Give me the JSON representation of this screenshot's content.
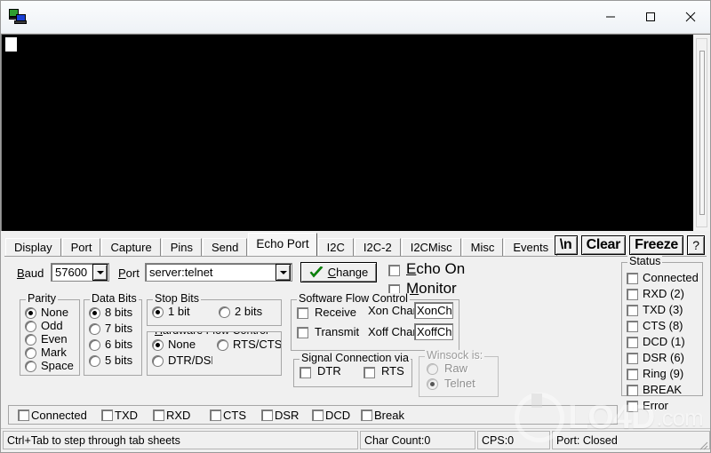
{
  "window": {
    "title": "",
    "icon": "network-computers-icon",
    "controls": {
      "minimize": "minimize-icon",
      "maximize": "maximize-icon",
      "close": "close-icon"
    }
  },
  "terminal": {
    "content": "",
    "background": "#000000",
    "caret": "block-cursor"
  },
  "tabs": [
    {
      "label": "Display",
      "active": false
    },
    {
      "label": "Port",
      "active": false
    },
    {
      "label": "Capture",
      "active": false
    },
    {
      "label": "Pins",
      "active": false
    },
    {
      "label": "Send",
      "active": false
    },
    {
      "label": "Echo Port",
      "active": true
    },
    {
      "label": "I2C",
      "active": false
    },
    {
      "label": "I2C-2",
      "active": false
    },
    {
      "label": "I2CMisc",
      "active": false
    },
    {
      "label": "Misc",
      "active": false
    },
    {
      "label": "Events",
      "active": false
    }
  ],
  "toolbuttons": [
    {
      "label": "\\n",
      "name": "newline-button"
    },
    {
      "label": "Clear",
      "name": "clear-button"
    },
    {
      "label": "Freeze",
      "name": "freeze-button"
    },
    {
      "label": "?",
      "name": "help-button"
    }
  ],
  "port_row": {
    "baud_label": "Baud",
    "baud_value": "57600",
    "port_label": "Port",
    "port_value": "server:telnet",
    "change_button": "Change"
  },
  "echo": {
    "echo_on_label": "Echo On",
    "echo_on_checked": false,
    "monitor_label": "Monitor",
    "monitor_checked": false
  },
  "parity": {
    "title": "Parity",
    "options": [
      "None",
      "Odd",
      "Even",
      "Mark",
      "Space"
    ],
    "selected": "None"
  },
  "data_bits": {
    "title": "Data Bits",
    "options": [
      "8 bits",
      "7 bits",
      "6 bits",
      "5 bits"
    ],
    "selected": "8 bits"
  },
  "stop_bits": {
    "title": "Stop Bits",
    "options": [
      "1 bit",
      "2 bits"
    ],
    "selected": "1 bit"
  },
  "hardware_flow": {
    "title": "Hardware Flow Control",
    "options": [
      "None",
      "RTS/CTS",
      "DTR/DSR"
    ],
    "selected": "None"
  },
  "software_flow": {
    "title": "Software Flow Control",
    "receive_label": "Receive",
    "receive_checked": false,
    "transmit_label": "Transmit",
    "transmit_checked": false,
    "xon_label": "Xon Char:",
    "xon_value": "XonChar",
    "xoff_label": "Xoff Char:",
    "xoff_value": "XoffChar"
  },
  "signal_connection": {
    "title": "Signal Connection via",
    "dtr_label": "DTR",
    "dtr_checked": false,
    "rts_label": "RTS",
    "rts_checked": false
  },
  "winsock": {
    "title": "Winsock is:",
    "enabled": false,
    "options": [
      "Raw",
      "Telnet"
    ],
    "selected": "Telnet"
  },
  "status_panel": {
    "title": "Status",
    "items": [
      {
        "label": "Connected",
        "checked": false
      },
      {
        "label": "RXD (2)",
        "checked": false
      },
      {
        "label": "TXD (3)",
        "checked": false
      },
      {
        "label": "CTS (8)",
        "checked": false
      },
      {
        "label": "DCD (1)",
        "checked": false
      },
      {
        "label": "DSR (6)",
        "checked": false
      },
      {
        "label": "Ring (9)",
        "checked": false
      },
      {
        "label": "BREAK",
        "checked": false
      },
      {
        "label": "Error",
        "checked": false
      }
    ]
  },
  "bottom_flags": [
    {
      "label": "Connected",
      "checked": false
    },
    {
      "label": "TXD",
      "checked": false
    },
    {
      "label": "RXD",
      "checked": false
    },
    {
      "label": "CTS",
      "checked": false
    },
    {
      "label": "DSR",
      "checked": false
    },
    {
      "label": "DCD",
      "checked": false
    },
    {
      "label": "Break",
      "checked": false
    }
  ],
  "statusbar": {
    "hint": "Ctrl+Tab to step through tab sheets",
    "char_count": "Char Count:0",
    "cps": "CPS:0",
    "port_state": "Port: Closed"
  },
  "watermark": {
    "name": "LO4D",
    "suffix": ".com"
  }
}
